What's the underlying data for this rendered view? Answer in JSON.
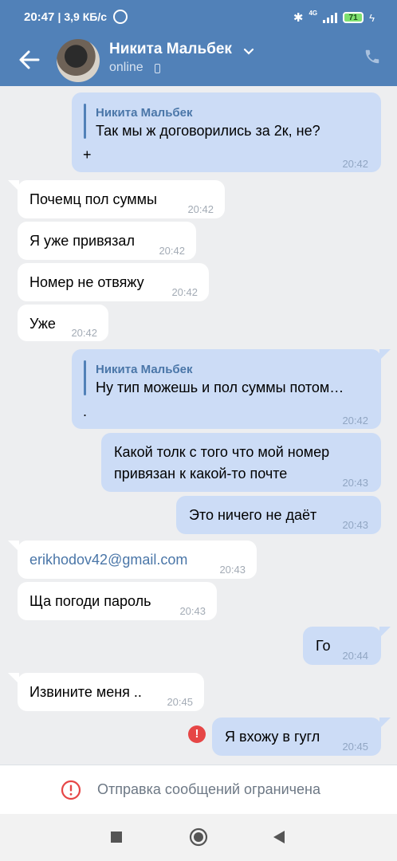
{
  "status_bar": {
    "time": "20:47",
    "speed": "| 3,9 КБ/с",
    "network_label": "4G",
    "battery": "71"
  },
  "header": {
    "name": "Никита Мальбек",
    "status": "online"
  },
  "messages": [
    {
      "dir": "out",
      "reply_name": "Никита Мальбек",
      "reply_text": "Так мы ж договорились за 2к, не?",
      "text": "+",
      "time": "20:42"
    },
    {
      "dir": "in",
      "text": "Почемц пол суммы",
      "time": "20:42"
    },
    {
      "dir": "in",
      "text": "Я уже привязал",
      "time": "20:42"
    },
    {
      "dir": "in",
      "text": "Номер не отвяжу",
      "time": "20:42"
    },
    {
      "dir": "in",
      "text": "Уже",
      "time": "20:42"
    },
    {
      "dir": "out",
      "reply_name": "Никита Мальбек",
      "reply_text": "Ну тип можешь и пол суммы потом…",
      "text": ".",
      "time": "20:42"
    },
    {
      "dir": "out",
      "text_line1": "Какой толк  с того что мой номер",
      "text_line2": "привязан к какой-то почте",
      "time": "20:43"
    },
    {
      "dir": "out",
      "text": "Это ничего не даёт",
      "time": "20:43"
    },
    {
      "dir": "in",
      "text": "erikhodov42@gmail.com",
      "time": "20:43"
    },
    {
      "dir": "in",
      "text": "Ща погоди пароль",
      "time": "20:43"
    },
    {
      "dir": "out",
      "text": "Го",
      "time": "20:44"
    },
    {
      "dir": "in",
      "text": "Извините меня ..",
      "time": "20:45"
    },
    {
      "dir": "out",
      "text": "Я вхожу в гугл",
      "time": "20:45",
      "error": "!"
    }
  ],
  "restriction": {
    "text": "Отправка сообщений ограничена"
  },
  "colors": {
    "header": "#5181b8",
    "outgoing_bubble": "#ccdcf6",
    "incoming_bubble": "#ffffff",
    "background": "#edeef0",
    "error": "#e64646"
  },
  "icons": [
    "back-arrow-icon",
    "chevron-down-icon",
    "phone-icon",
    "mobile-icon",
    "error-icon",
    "restriction-icon",
    "nav-recents-icon",
    "nav-home-icon",
    "nav-back-icon"
  ]
}
